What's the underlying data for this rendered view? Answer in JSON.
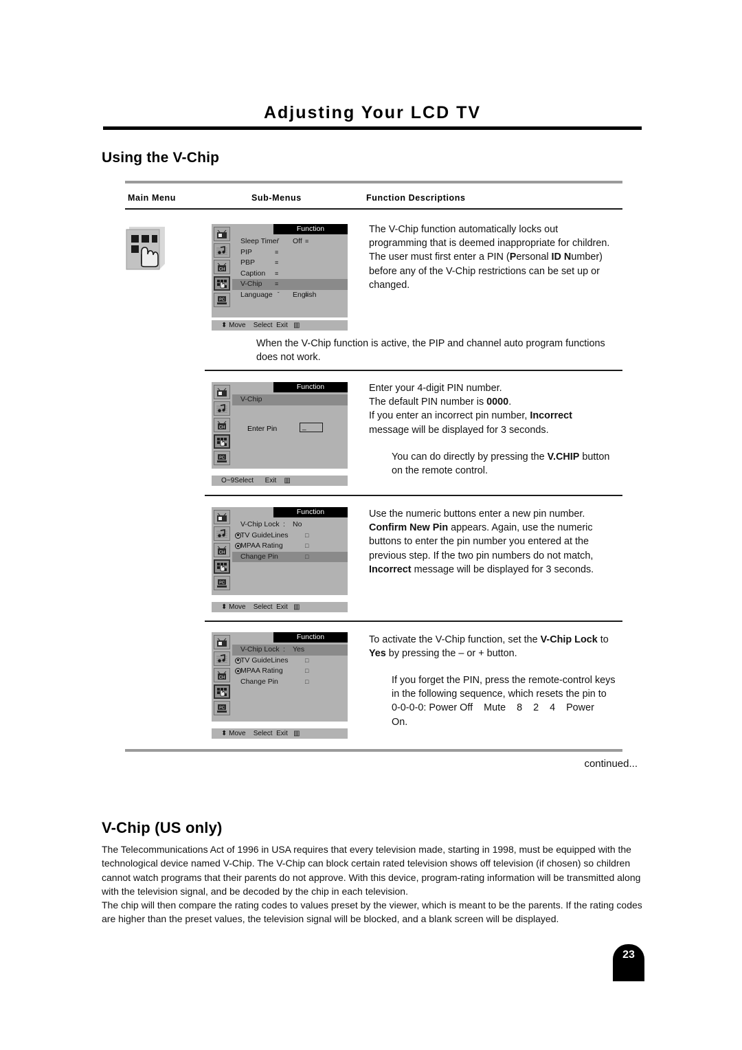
{
  "header": {
    "title": "Adjusting Your LCD TV"
  },
  "section": {
    "using_vchip_title": "Using the V-Chip",
    "us_only_title": "V-Chip (US only)"
  },
  "table_head": {
    "main_menu": "Main Menu",
    "sub_menus": "Sub-Menus",
    "function_descriptions": "Function Descriptions"
  },
  "main_icon": {
    "name": "function-menu-icon"
  },
  "rail_icons": [
    {
      "name": "picture-icon",
      "label": "TV"
    },
    {
      "name": "sound-icon",
      "label": "Note"
    },
    {
      "name": "channel-icon",
      "label": "CH"
    },
    {
      "name": "function-icon",
      "label": "Function"
    },
    {
      "name": "pc-icon",
      "label": "PC"
    }
  ],
  "osd1": {
    "title": "Function",
    "items": [
      {
        "label": "Sleep Timer",
        "value": "Off",
        "arrow": "˘",
        "marker": "",
        "marker2": "≡"
      },
      {
        "label": "PIP",
        "value": "",
        "marker": "≡"
      },
      {
        "label": "PBP",
        "value": "",
        "marker": "≡"
      },
      {
        "label": "Caption",
        "value": "",
        "marker": "≡"
      },
      {
        "label": "V-Chip",
        "value": "",
        "marker": "≡",
        "highlight": true
      },
      {
        "label": "Language",
        "value": "English",
        "arrow": "˘",
        "marker": "",
        "marker2": "≡"
      }
    ],
    "footer": "⬍ Move    Select  Exit   ▥"
  },
  "osd2": {
    "title": "Function",
    "header_item": "V-Chip",
    "pin_label": "Enter Pin",
    "pin_value": "_",
    "footer": "O~9Select      Exit    ▥"
  },
  "osd3": {
    "title": "Function",
    "items": [
      {
        "label": "V-Chip Lock",
        "colon": ":",
        "value": "No"
      },
      {
        "label": "TV GuideLines",
        "bullet": true,
        "marker2": "□"
      },
      {
        "label": "MPAA Rating",
        "bullet": true,
        "marker2": "□"
      },
      {
        "label": "Change Pin",
        "marker2": "□",
        "highlight": true
      }
    ],
    "footer": "⬍ Move    Select  Exit   ▥"
  },
  "osd4": {
    "title": "Function",
    "items": [
      {
        "label": "V-Chip Lock",
        "colon": ":",
        "value": "Yes",
        "highlight": true
      },
      {
        "label": "TV GuideLines",
        "bullet": true,
        "marker2": "□"
      },
      {
        "label": "MPAA Rating",
        "bullet": true,
        "marker2": "□"
      },
      {
        "label": "Change Pin",
        "marker2": "□"
      }
    ],
    "footer": "⬍ Move    Select  Exit   ▥"
  },
  "descriptions": {
    "row1": {
      "line1": "The V-Chip function automatically locks out",
      "line2": "programming that is deemed inappropriate for children.",
      "line3_a": "The user must first enter a PIN (",
      "line3_b": "P",
      "line3_c": "ersonal ",
      "line3_d": "ID N",
      "line3_e": "umber)",
      "line4": "before any of the V-Chip restrictions can be set up or",
      "line5": "changed."
    },
    "row1_note": {
      "line1": "When the V-Chip function is active, the PIP and channel auto program functions",
      "line2": "does not work."
    },
    "row2": {
      "line1": "Enter your 4-digit PIN number.",
      "line2_a": "The default PIN number is ",
      "line2_b": "0000",
      "line2_c": ".",
      "line3_a": "If you enter an incorrect pin number, ",
      "line3_b": "Incorrect",
      "line4": "message will be displayed for 3 seconds."
    },
    "row2_note": {
      "line1_a": "You can do directly by pressing the ",
      "line1_b": "V.CHIP",
      "line1_c": " button",
      "line2": "on the remote control."
    },
    "row3": {
      "line1": "Use the numeric buttons enter a new pin number.",
      "line2_a": "Confirm New Pin",
      "line2_b": " appears. Again, use the numeric",
      "line3": "buttons to enter the pin number you entered at the",
      "line4": "previous step. If the two pin numbers do not match,",
      "line5_a": "Incorrect",
      "line5_b": " message will be displayed for 3 seconds."
    },
    "row4": {
      "line1_a": "To activate the V-Chip function, set the ",
      "line1_b": "V-Chip Lock",
      "line1_c": " to",
      "line2_a": "Yes",
      "line2_b": " by pressing the – or + button."
    },
    "row4_note": {
      "line1": "If you forget the PIN, press the remote-control keys",
      "line2": "in the following sequence, which resets the pin to",
      "line3": "0-0-0-0: Power Off    Mute    8    2    4    Power",
      "line4": "On."
    }
  },
  "continued": "continued...",
  "us_paragraphs": {
    "p1": "The Telecommunications Act of 1996 in USA requires that every television made, starting in 1998, must be equipped with the technological device named V-Chip. The V-Chip can block certain rated television shows off television (if chosen) so children cannot watch programs that their parents do not approve. With this device, program-rating information will be transmitted along with the television signal, and be decoded by the chip in each television.",
    "p2": "The chip will then compare the rating codes to values preset by the viewer, which is meant to be the parents. If the rating codes are higher than the preset values, the television signal will be blocked, and a blank screen will be displayed."
  },
  "page_number": "23"
}
